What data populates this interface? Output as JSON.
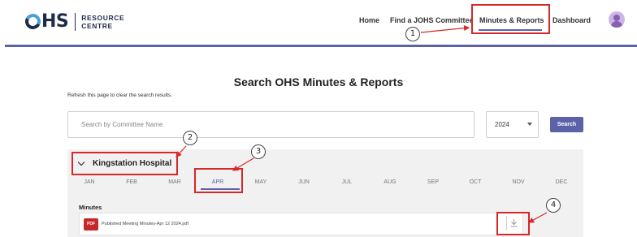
{
  "header": {
    "logo": {
      "mark": "OHS",
      "line1": "RESOURCE",
      "line2": "CENTRE"
    },
    "nav": [
      {
        "label": "Home",
        "active": false
      },
      {
        "label": "Find a JOHS Committee",
        "active": false
      },
      {
        "label": "Minutes & Reports",
        "active": true
      },
      {
        "label": "Dashboard",
        "active": false
      }
    ],
    "accent_color": "#5c62a8"
  },
  "page": {
    "title": "Search OHS Minutes & Reports",
    "refresh_note": "Refresh this page to clear the search results.",
    "search_placeholder": "Search by Committee Name",
    "year_value": "2024",
    "search_button": "Search"
  },
  "results": {
    "hospital": "Kingstation Hospital",
    "months": [
      "JAN",
      "FEB",
      "MAR",
      "APR",
      "MAY",
      "JUN",
      "JUL",
      "AUG",
      "SEP",
      "OCT",
      "NOV",
      "DEC"
    ],
    "selected_month": "APR",
    "section_label": "Minutes",
    "file_badge": "PDF",
    "file_name": "Published Meeting Minutes-Apr 12 2024.pdf"
  },
  "annotations": {
    "color": "#d62828",
    "labels": [
      "1",
      "2",
      "3",
      "4"
    ]
  }
}
